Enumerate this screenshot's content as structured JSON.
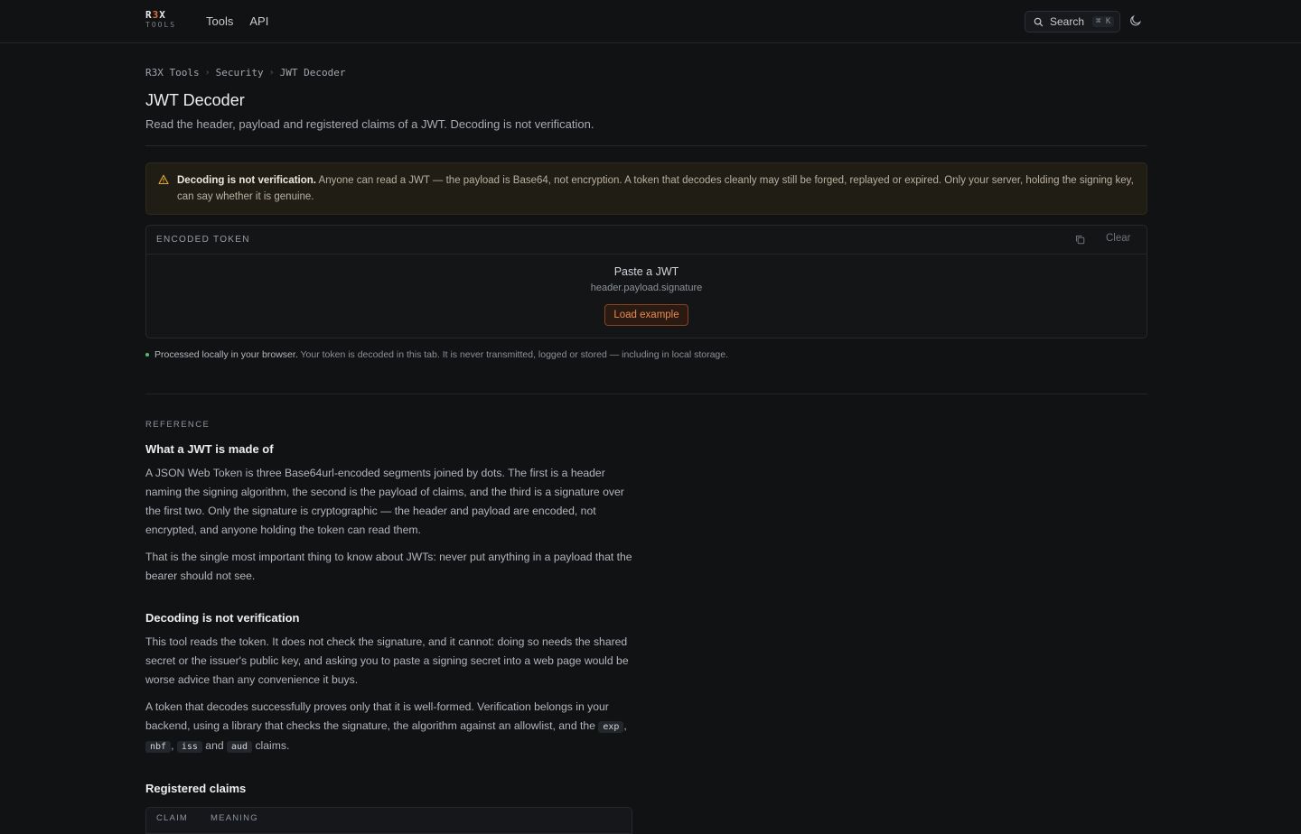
{
  "header": {
    "logo_main_a": "R",
    "logo_main_accent": "3",
    "logo_main_b": "X",
    "logo_sub": "TOOLS",
    "nav": [
      "Tools",
      "API"
    ],
    "search_label": "Search",
    "search_shortcut": "⌘ K",
    "theme_icon": "moon-icon"
  },
  "breadcrumb": [
    "R3X Tools",
    "Security",
    "JWT Decoder"
  ],
  "page": {
    "title": "JWT Decoder",
    "subtitle": "Read the header, payload and registered claims of a JWT. Decoding is not verification."
  },
  "warning": {
    "icon": "warning-triangle-icon",
    "bold": "Decoding is not verification.",
    "text": " Anyone can read a JWT — the payload is Base64, not encryption. A token that decodes cleanly may still be forged, replayed or expired. Only your server, holding the signing key, can say whether it is genuine.",
    "color": "#e0a93a"
  },
  "token": {
    "label": "ENCODED TOKEN",
    "clear_label": "Clear",
    "copy_icon": "copy-icon",
    "paste_title": "Paste a JWT",
    "paste_hint": "header.payload.signature",
    "load_example": "Load example",
    "accent": "#e2703a"
  },
  "privacy": {
    "bold": "Processed locally in your browser.",
    "text": " Your token is decoded in this tab. It is never transmitted, logged or stored — including in local storage.",
    "status_color": "#4fbf6f"
  },
  "reference": {
    "label": "REFERENCE",
    "sections": [
      {
        "heading": "What a JWT is made of",
        "paragraphs": [
          "A JSON Web Token is three Base64url-encoded segments joined by dots. The first is a header naming the signing algorithm, the second is the payload of claims, and the third is a signature over the first two. Only the signature is cryptographic — the header and payload are encoded, not encrypted, and anyone holding the token can read them.",
          "That is the single most important thing to know about JWTs: never put anything in a payload that the bearer should not see."
        ]
      },
      {
        "heading": "Decoding is not verification",
        "paragraphs": [
          "This tool reads the token. It does not check the signature, and it cannot: doing so needs the shared secret or the issuer's public key, and asking you to paste a signing secret into a web page would be worse advice than any convenience it buys."
        ],
        "last_paragraph_prefix": "A token that decodes successfully proves only that it is well-formed. Verification belongs in your backend, using a library that checks the signature, the algorithm against an allowlist, and the ",
        "claims_inline": [
          "exp",
          "nbf",
          "iss",
          "aud"
        ],
        "sep_comma": ", ",
        "sep_and": " and ",
        "last_paragraph_suffix": " claims."
      }
    ],
    "claims_heading": "Registered claims",
    "table_headers": [
      "CLAIM",
      "MEANING"
    ]
  }
}
